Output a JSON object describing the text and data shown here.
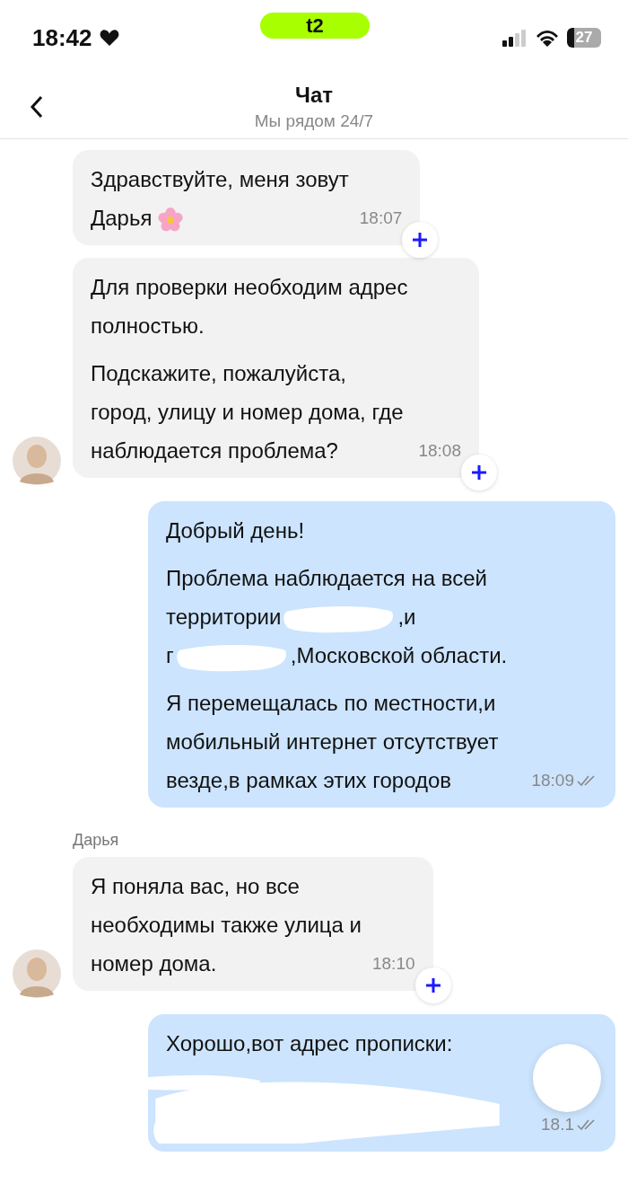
{
  "status_bar": {
    "time": "18:42",
    "carrier": "t2",
    "battery": "27"
  },
  "header": {
    "title": "Чат",
    "subtitle": "Мы рядом 24/7"
  },
  "messages": [
    {
      "kind": "incoming",
      "avatar": false,
      "paragraphs": [
        {
          "lines": [
            "Здравствуйте, меня зовут",
            "Дарья"
          ],
          "flower": true
        }
      ],
      "time": "18:07"
    },
    {
      "kind": "incoming",
      "avatar": true,
      "paragraphs": [
        {
          "lines": [
            "Для проверки необходим адрес",
            "полностью."
          ]
        },
        {
          "lines": [
            "Подскажите, пожалуйста,",
            "город, улицу и номер дома, где",
            "наблюдается проблема?"
          ]
        }
      ],
      "time": "18:08"
    },
    {
      "kind": "outgoing",
      "read": true,
      "paragraphs": [
        {
          "lines": [
            "Добрый день!"
          ]
        },
        {
          "kind": "redacted",
          "segments": [
            {
              "kind": "text",
              "text": "Проблема наблюдается на всей"
            },
            {
              "kind": "break"
            },
            {
              "kind": "text",
              "text": "территории"
            },
            {
              "kind": "redaction"
            },
            {
              "kind": "text",
              "text": ",и"
            },
            {
              "kind": "break"
            },
            {
              "kind": "text",
              "text": "г"
            },
            {
              "kind": "redaction"
            },
            {
              "kind": "text",
              "text": ",Московской области."
            }
          ]
        },
        {
          "lines": [
            "Я перемещалась по местности,и",
            "мобильный интернет отсутствует",
            "везде,в рамках этих городов"
          ]
        }
      ],
      "time": "18:09"
    },
    {
      "kind": "incoming",
      "avatar": true,
      "sender": "Дарья",
      "paragraphs": [
        {
          "lines": [
            "Я поняла вас, но все",
            "необходимы также улица и",
            "номер дома."
          ]
        }
      ],
      "time": "18:10"
    },
    {
      "kind": "outgoing",
      "read": true,
      "paragraphs": [
        {
          "lines": [
            "Хорошо,вот адрес прописки:"
          ]
        },
        {
          "kind": "block_redaction"
        }
      ],
      "time": "18.1"
    }
  ]
}
